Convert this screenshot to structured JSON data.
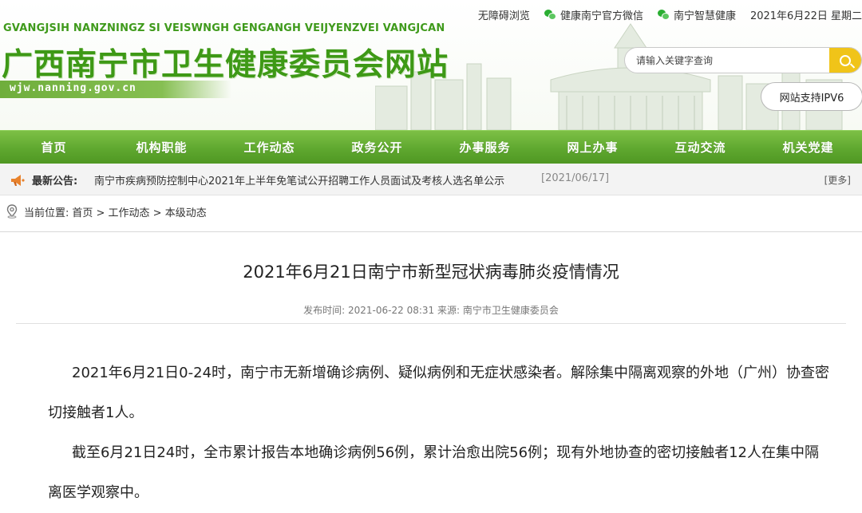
{
  "header": {
    "pinyin": "GVANGJSIH NANZNINGZ SI VEISWNGH GENGANGH VEIJYENZVEI VANGJCAN",
    "title": "广西南宁市卫生健康委员会网站",
    "domain": "wjw.nanning.gov.cn",
    "toplinks": {
      "accessible": "无障碍浏览",
      "wechat_official": "健康南宁官方微信",
      "wechat_smart": "南宁智慧健康",
      "date": "2021年6月22日 星期二"
    },
    "search": {
      "placeholder": "请输入关键字查询"
    },
    "ipv6": "网站支持IPV6"
  },
  "nav": {
    "items": [
      {
        "label": "首页"
      },
      {
        "label": "机构职能"
      },
      {
        "label": "工作动态"
      },
      {
        "label": "政务公开"
      },
      {
        "label": "办事服务"
      },
      {
        "label": "网上办事"
      },
      {
        "label": "互动交流"
      },
      {
        "label": "机关党建"
      }
    ]
  },
  "notice": {
    "label": "最新公告:",
    "text": "南宁市疾病预防控制中心2021年上半年免笔试公开招聘工作人员面试及考核人选名单公示",
    "date": "[2021/06/17]",
    "more": "[更多]"
  },
  "breadcrumb": {
    "prefix": "当前位置:",
    "path": "首页 > 工作动态 > 本级动态"
  },
  "article": {
    "title": "2021年6月21日南宁市新型冠状病毒肺炎疫情情况",
    "meta": "发布时间: 2021-06-22 08:31    来源: 南宁市卫生健康委员会",
    "paragraphs": [
      "2021年6月21日0-24时，南宁市无新增确诊病例、疑似病例和无症状感染者。解除集中隔离观察的外地（广州）协查密切接触者1人。",
      "截至6月21日24时，全市累计报告本地确诊病例56例，累计治愈出院56例；现有外地协查的密切接触者12人在集中隔离医学观察中。"
    ]
  },
  "colors": {
    "brand_green": "#3e9916",
    "nav_green": "#5fa82f",
    "search_yellow": "#f0c419",
    "wechat_green": "#2aae32"
  },
  "icons": [
    "wechat-icon",
    "search-icon",
    "megaphone-icon",
    "location-pin-icon"
  ]
}
